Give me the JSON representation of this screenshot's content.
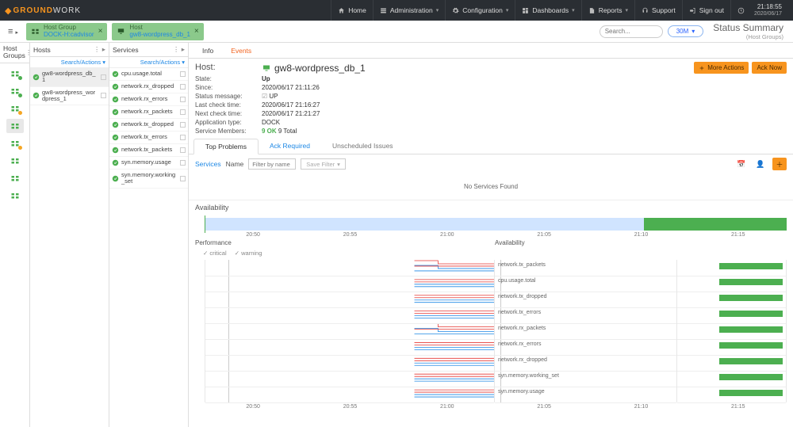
{
  "nav": {
    "logo_prefix": "GROUND",
    "logo_suffix": "WORK",
    "items": [
      {
        "label": "Home"
      },
      {
        "label": "Administration"
      },
      {
        "label": "Configuration"
      },
      {
        "label": "Dashboards"
      },
      {
        "label": "Reports"
      },
      {
        "label": "Support"
      },
      {
        "label": "Sign out"
      }
    ],
    "time": "21:18:55",
    "date": "2020/06/17"
  },
  "secondBar": {
    "tabs": [
      {
        "type": "Host Group",
        "name": "DOCK-H:cadvisor"
      },
      {
        "type": "Host",
        "name": "gw8-wordpress_db_1"
      }
    ],
    "search_placeholder": "Search...",
    "time_pill": "30M",
    "summary_title": "Status Summary",
    "summary_sub": "(Host Groups)"
  },
  "cols": {
    "hg_title": "Host Groups",
    "hosts_title": "Hosts",
    "svcs_title": "Services",
    "search_actions": "Search/Actions",
    "host_groups_count": 8,
    "hosts": [
      {
        "name": "gw8-wordpress_db_1",
        "selected": true
      },
      {
        "name": "gw8-wordpress_wordpress_1",
        "selected": false
      }
    ],
    "services": [
      "cpu.usage.total",
      "network.rx_dropped",
      "network.rx_errors",
      "network.rx_packets",
      "network.tx_dropped",
      "network.tx_errors",
      "network.tx_packets",
      "syn.memory.usage",
      "syn.memory.working_set"
    ]
  },
  "tabs": {
    "info": "Info",
    "events": "Events"
  },
  "host": {
    "label_host": "Host:",
    "name": "gw8-wordpress_db_1",
    "fields": {
      "state_l": "State:",
      "state_v": "Up",
      "since_l": "Since:",
      "since_v": "2020/06/17 21:11:26",
      "status_l": "Status message:",
      "status_v": "UP",
      "last_l": "Last check time:",
      "last_v": "2020/06/17 21:16:27",
      "next_l": "Next check time:",
      "next_v": "2020/06/17 21:21:27",
      "app_l": "Application type:",
      "app_v": "DOCK",
      "members_l": "Service Members:",
      "members_ok": "9 OK",
      "members_total": "9 Total"
    },
    "more_actions": "More Actions",
    "ack_now": "Ack Now",
    "subtabs": {
      "top": "Top Problems",
      "ack": "Ack Required",
      "un": "Unscheduled Issues"
    },
    "filter": {
      "services": "Services",
      "name": "Name",
      "filter_placeholder": "Filter by name",
      "save": "Save Filter"
    },
    "no_services": "No Services Found",
    "availability_title": "Availability",
    "perf_title": "Performance",
    "avail_col_title": "Availability",
    "legend_critical": "critical",
    "legend_warning": "warning"
  },
  "chart_data": [
    {
      "type": "bar",
      "title": "Availability",
      "x_timeline": [
        "20:50",
        "20:55",
        "21:00",
        "21:05",
        "21:10",
        "21:15"
      ],
      "segments": [
        {
          "state": "no-data",
          "from": "20:48",
          "to": "21:11",
          "color": "#d0e4ff"
        },
        {
          "state": "Up",
          "from": "21:11",
          "to": "21:19",
          "color": "#4caf50"
        }
      ]
    },
    {
      "type": "line",
      "title": "Performance",
      "x_timeline": [
        "20:50",
        "20:55",
        "21:00",
        "21:05",
        "21:10",
        "21:15"
      ],
      "xlabel": "",
      "ylabel": "",
      "legend": [
        "critical",
        "warning"
      ],
      "series_grouping": "per-service thresholds (critical=red, warning=blue) shown only after 21:11",
      "services": [
        "network.tx_packets",
        "cpu.usage.total",
        "network.tx_dropped",
        "network.tx_errors",
        "network.rx_packets",
        "network.rx_errors",
        "network.rx_dropped",
        "syn.memory.working_set",
        "syn.memory.usage"
      ],
      "notes": "Two services show a step change between 21:05 and 21:10; all lines start near 21:02–21:11 range; y-values unlabeled.",
      "availability_bars": {
        "value": 100,
        "unit": "%",
        "per_service": true
      }
    }
  ],
  "perf_rows": [
    "network.tx_packets",
    "cpu.usage.total",
    "network.tx_dropped",
    "network.tx_errors",
    "network.rx_packets",
    "network.rx_errors",
    "network.rx_dropped",
    "syn.memory.working_set",
    "syn.memory.usage"
  ],
  "axes": {
    "top": [
      "20:50",
      "20:55",
      "21:00",
      "21:05",
      "21:10",
      "21:15"
    ],
    "bottom": [
      "20:50",
      "20:55",
      "21:00",
      "21:05",
      "21:10",
      "21:15"
    ]
  }
}
